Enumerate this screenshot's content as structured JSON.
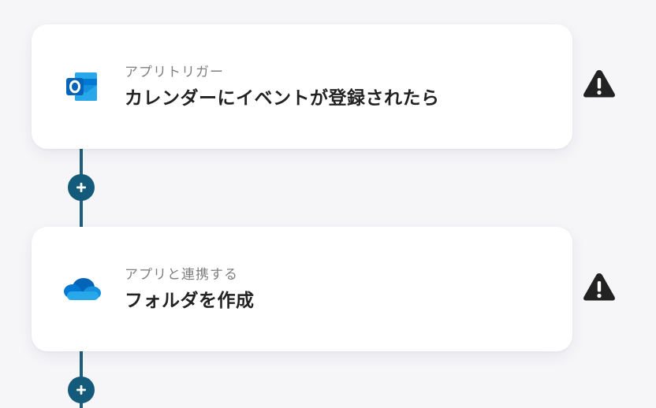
{
  "flow": {
    "steps": [
      {
        "subtitle": "アプリトリガー",
        "title": "カレンダーにイベントが登録されたら",
        "app_icon": "outlook-icon",
        "status_icon": "warning-icon"
      },
      {
        "subtitle": "アプリと連携する",
        "title": "フォルダを作成",
        "app_icon": "onedrive-icon",
        "status_icon": "warning-icon"
      }
    ],
    "add_step_icon": "plus-icon"
  },
  "colors": {
    "background": "#f6f5f8",
    "card": "#ffffff",
    "connector": "#1f5f7a",
    "add_button": "#145a7a",
    "warning": "#222222"
  }
}
